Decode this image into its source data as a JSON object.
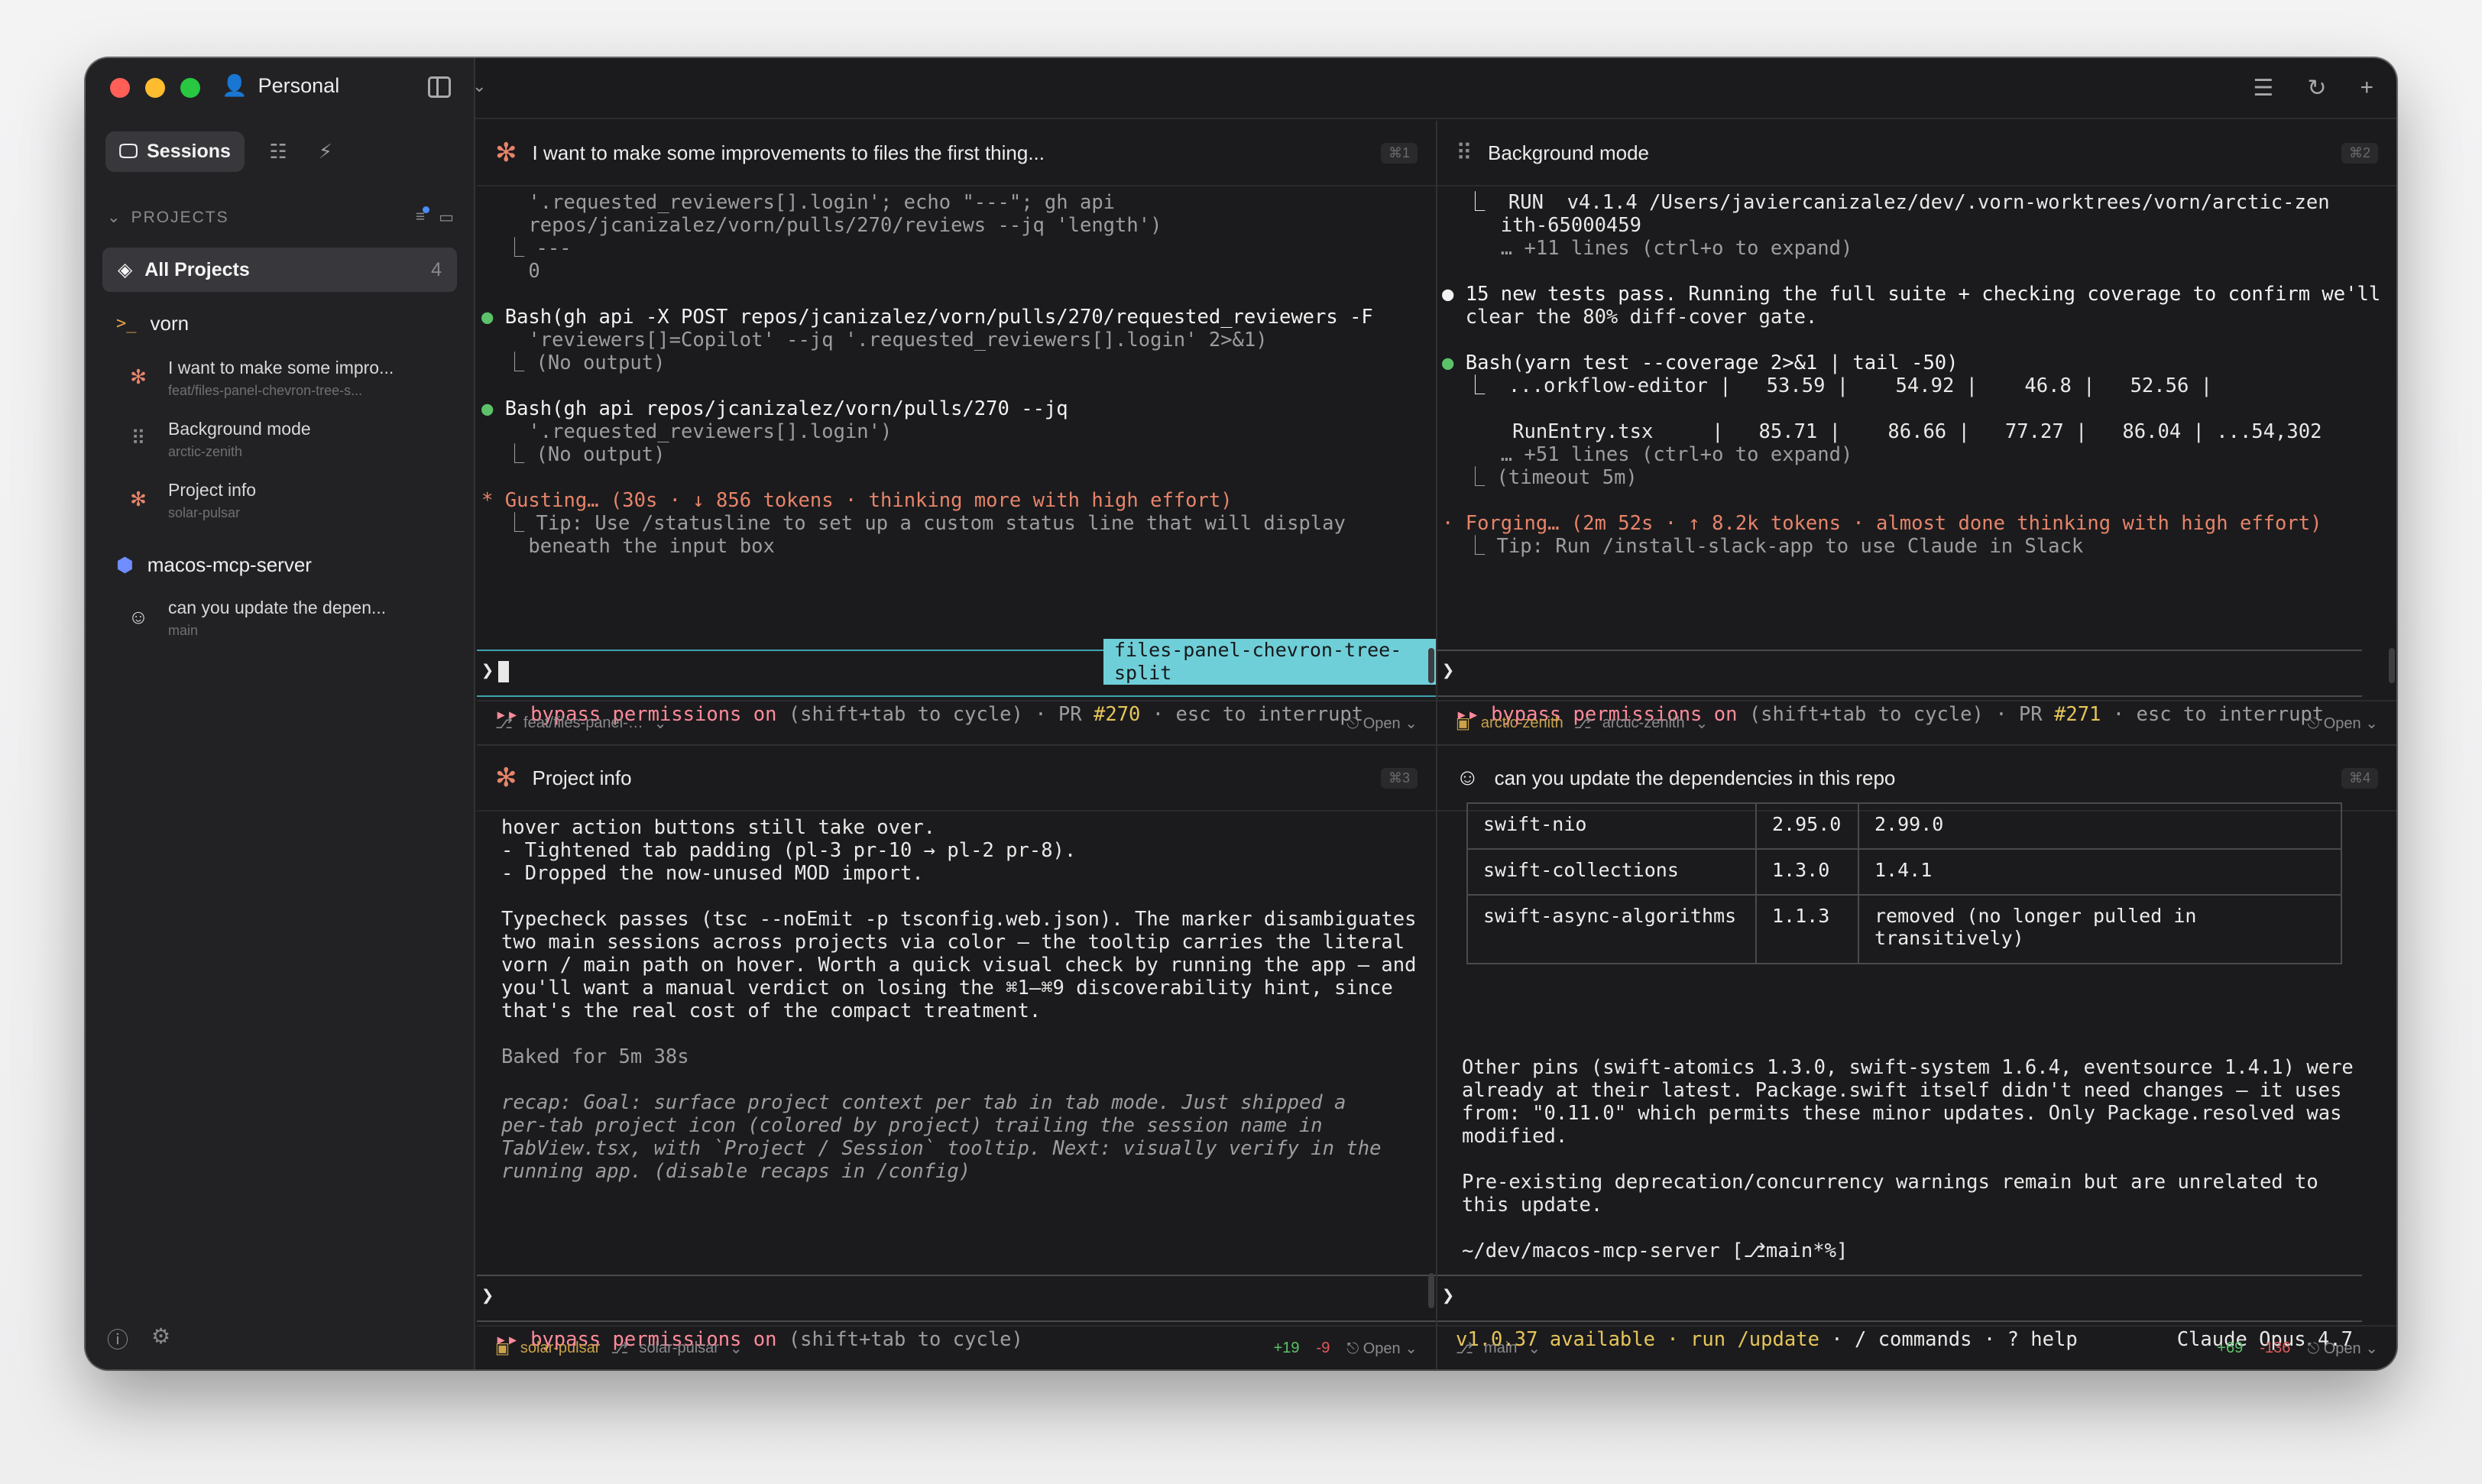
{
  "sidebar": {
    "profile": "Personal",
    "tabs": {
      "sessions": "Sessions"
    },
    "projects_label": "PROJECTS",
    "all_projects": {
      "label": "All Projects",
      "count": "4"
    },
    "projects": [
      {
        "name": "vorn",
        "sessions": [
          {
            "title": "I want to make some impro...",
            "sub": "feat/files-panel-chevron-tree-s..."
          },
          {
            "title": "Background mode",
            "sub": "arctic-zenith"
          },
          {
            "title": "Project info",
            "sub": "solar-pulsar"
          }
        ]
      },
      {
        "name": "macos-mcp-server",
        "sessions": [
          {
            "title": "can you update the depen...",
            "sub": "main"
          }
        ]
      }
    ]
  },
  "panes": {
    "p1": {
      "title": "I want to make some improvements to files the first thing...",
      "kbd": "⌘1",
      "lines": [
        "    '.requested_reviewers[].login'; echo \"---\"; gh api",
        "    repos/jcanizalez/vorn/pulls/270/reviews --jq 'length')",
        "  ⎿ ---",
        "    0",
        "",
        "Bash(gh api -X POST repos/jcanizalez/vorn/pulls/270/requested_reviewers -F",
        "    'reviewers[]=Copilot' --jq '.requested_reviewers[].login' 2>&1)",
        "  ⎿ (No output)",
        "",
        "Bash(gh api repos/jcanizalez/vorn/pulls/270 --jq",
        "    '.requested_reviewers[].login')",
        "  ⎿ (No output)",
        "",
        "Gusting… (30s · ↓ 856 tokens · thinking more with high effort)",
        "  ⎿ Tip: Use /statusline to set up a custom status line that will display",
        "    beneath the input box"
      ],
      "branch_tag": "files-panel-chevron-tree-split",
      "status": {
        "mode": "bypass permissions on",
        "hint": "(shift+tab to cycle) · PR",
        "pr": "#270",
        "tail": "· esc to interrupt"
      },
      "foot": {
        "branch": "feat/files-panel-…",
        "open": "Open"
      }
    },
    "p2": {
      "title": "Background mode",
      "kbd": "⌘2",
      "lines": [
        "  ⎿  RUN  v4.1.4 /Users/javiercanizalez/dev/.vorn-worktrees/vorn/arctic-zen",
        "     ith-65000459",
        "     … +11 lines (ctrl+o to expand)",
        "",
        "15 new tests pass. Running the full suite + checking coverage to confirm we'll",
        "  clear the 80% diff-cover gate.",
        "",
        "Bash(yarn test --coverage 2>&1 | tail -50)",
        "  ⎿  ...orkflow-editor |   53.59 |    54.92 |    46.8 |   52.56 |",
        "",
        "      RunEntry.tsx     |   85.71 |    86.66 |   77.27 |   86.04 | ...54,302",
        "     … +51 lines (ctrl+o to expand)",
        "  ⎿ (timeout 5m)",
        "",
        "Forging… (2m 52s · ↑ 8.2k tokens · almost done thinking with high effort)",
        "  ⎿ Tip: Run /install-slack-app to use Claude in Slack"
      ],
      "status": {
        "mode": "bypass permissions on",
        "hint": "(shift+tab to cycle) · PR",
        "pr": "#271",
        "tail": "· esc to interrupt"
      },
      "foot": {
        "worktree": "arctic-zenith",
        "branch": "arctic-zenith",
        "open": "Open"
      }
    },
    "p3": {
      "title": "Project info",
      "kbd": "⌘3",
      "lines": [
        "hover action buttons still take over.",
        "- Tightened tab padding (pl-3 pr-10 → pl-2 pr-8).",
        "- Dropped the now-unused MOD import.",
        "",
        "Typecheck passes (tsc --noEmit -p tsconfig.web.json). The marker disambiguates",
        "two main sessions across projects via color — the tooltip carries the literal",
        "vorn / main path on hover. Worth a quick visual check by running the app — and",
        "you'll want a manual verdict on losing the ⌘1–⌘9 discoverability hint, since",
        "that's the real cost of the compact treatment.",
        "",
        "Baked for 5m 38s",
        "",
        "recap: Goal: surface project context per tab in tab mode. Just shipped a",
        "per-tab project icon (colored by project) trailing the session name in",
        "TabView.tsx, with `Project / Session` tooltip. Next: visually verify in the",
        "running app. (disable recaps in /config)"
      ],
      "status": {
        "mode": "bypass permissions on",
        "hint": "(shift+tab to cycle)"
      },
      "foot": {
        "worktree": "solar-pulsar",
        "branch": "solar-pulsar",
        "added": "+19",
        "removed": "-9",
        "open": "Open"
      }
    },
    "p4": {
      "title": "can you update the dependencies in this repo",
      "kbd": "⌘4",
      "table": [
        [
          "swift-nio",
          "2.95.0",
          "2.99.0"
        ],
        [
          "swift-collections",
          "1.3.0",
          "1.4.1"
        ],
        [
          "swift-async-algorithms",
          "1.1.3",
          "removed (no longer pulled in\ntransitively)"
        ]
      ],
      "lines": [
        "Other pins (swift-atomics 1.3.0, swift-system 1.6.4, eventsource 1.4.1) were",
        "already at their latest. Package.swift itself didn't need changes — it uses",
        "from: \"0.11.0\" which permits these minor updates. Only Package.resolved was",
        "modified.",
        "",
        "Pre-existing deprecation/concurrency warnings remain but are unrelated to",
        "this update."
      ],
      "shell": "~/dev/macos-mcp-server [⎇main*%]",
      "status": {
        "update": "v1.0.37 available · run /update",
        "cmds": "· / commands · ? help",
        "model": "Claude Opus 4.7"
      },
      "foot": {
        "branch": "main",
        "added": "+69",
        "removed": "-136",
        "open": "Open"
      }
    }
  },
  "colors": {
    "accent_teal": "#6fcfd8",
    "bypass_pink": "#ff8a9a",
    "pr_yellow": "#e5c55a",
    "claude_orange": "#e7846a"
  }
}
